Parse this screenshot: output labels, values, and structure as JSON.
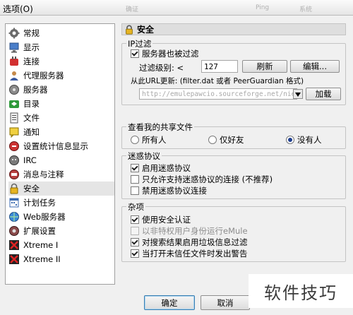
{
  "window": {
    "title": "选项(O)",
    "ghost_texts": [
      "确证",
      "Ping",
      "系统"
    ]
  },
  "sidebar": {
    "items": [
      {
        "label": "常规",
        "icon": "general-icon"
      },
      {
        "label": "显示",
        "icon": "display-icon"
      },
      {
        "label": "连接",
        "icon": "connection-icon"
      },
      {
        "label": "代理服务器",
        "icon": "proxy-icon"
      },
      {
        "label": "服务器",
        "icon": "server-icon"
      },
      {
        "label": "目录",
        "icon": "directory-icon"
      },
      {
        "label": "文件",
        "icon": "files-icon"
      },
      {
        "label": "通知",
        "icon": "notification-icon"
      },
      {
        "label": "设置统计信息显示",
        "icon": "statistics-icon"
      },
      {
        "label": "IRC",
        "icon": "irc-icon"
      },
      {
        "label": "消息与注释",
        "icon": "messages-icon"
      },
      {
        "label": "安全",
        "icon": "lock-icon",
        "selected": true
      },
      {
        "label": "计划任务",
        "icon": "scheduler-icon"
      },
      {
        "label": "Web服务器",
        "icon": "webserver-icon"
      },
      {
        "label": "扩展设置",
        "icon": "extended-icon"
      },
      {
        "label": "Xtreme I",
        "icon": "xtreme-icon"
      },
      {
        "label": "Xtreme II",
        "icon": "xtreme-icon"
      }
    ]
  },
  "content": {
    "header": "安全",
    "ipfilter": {
      "title": "IP过滤",
      "server_filter_label": "服务器也被过滤",
      "server_filter_checked": true,
      "level_label": "过滤级别: <",
      "level_value": "127",
      "refresh_label": "刷新",
      "edit_label": "编辑...",
      "update_label": "从此URL更新: (filter.dat 或者 PeerGuardian 格式)",
      "url_value": "http://emulepawcio.sourceforge.net/nieuwe_site/Ipfilter_fakes/ipfilter.zip",
      "load_label": "加载"
    },
    "shared": {
      "title": "查看我的共享文件",
      "options": [
        "所有人",
        "仅好友",
        "没有人"
      ],
      "selected_index": 2
    },
    "obfuscation": {
      "title": "迷惑协议",
      "items": [
        {
          "label": "启用迷惑协议",
          "checked": true
        },
        {
          "label": "只允许支持迷惑协议的连接 (不推荐)",
          "checked": false
        },
        {
          "label": "禁用迷惑协议连接",
          "checked": false
        }
      ]
    },
    "misc": {
      "title": "杂项",
      "items": [
        {
          "label": "使用安全认证",
          "checked": true,
          "disabled": false
        },
        {
          "label": "以非特权用户身份运行eMule",
          "checked": false,
          "disabled": true
        },
        {
          "label": "对搜索结果启用垃圾信息过滤",
          "checked": true,
          "disabled": false
        },
        {
          "label": "当打开未信任文件时发出警告",
          "checked": true,
          "disabled": false
        }
      ]
    }
  },
  "footer": {
    "ok_label": "确定",
    "cancel_label": "取消"
  },
  "watermark": "软件技巧"
}
